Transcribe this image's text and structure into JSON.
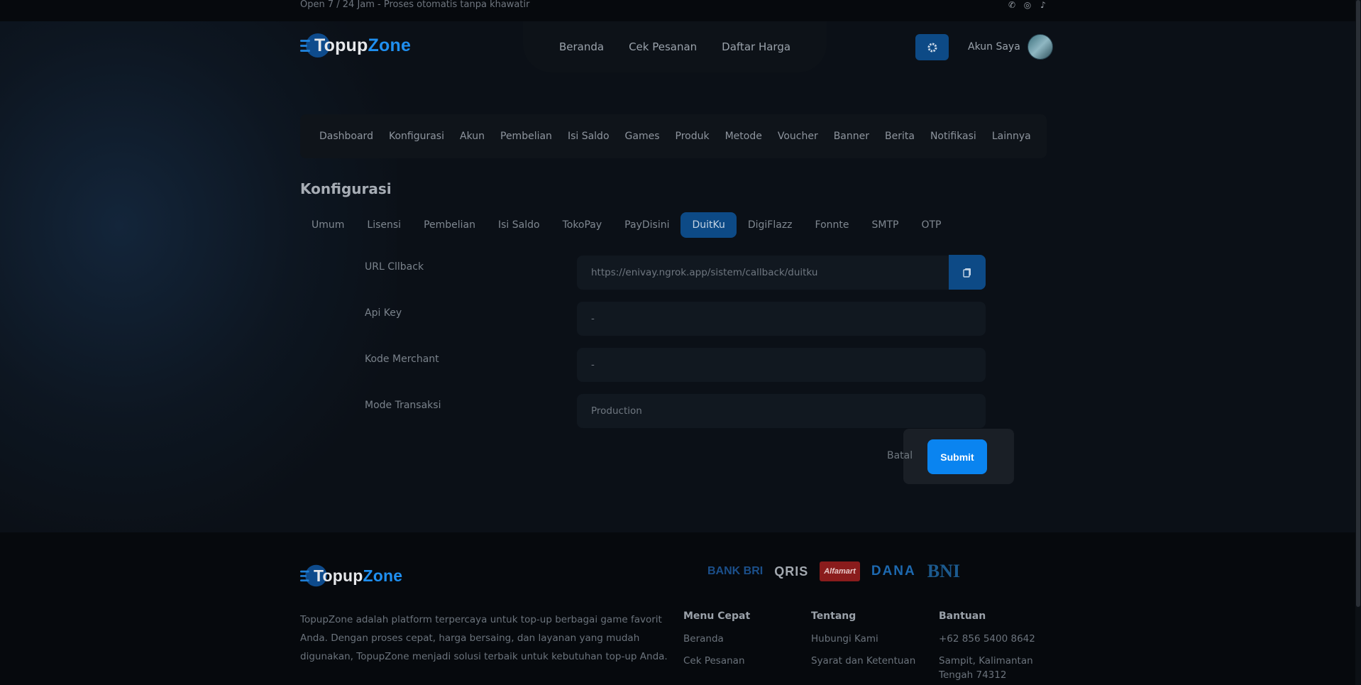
{
  "topbar": {
    "open_text": "Open 7 / 24 Jam - Proses otomatis tanpa khawatir",
    "socials": [
      {
        "icon": "whatsapp-icon"
      },
      {
        "icon": "instagram-icon"
      },
      {
        "icon": "tiktok-icon"
      }
    ]
  },
  "header": {
    "logo": {
      "part1": "Topup",
      "part2": "Z",
      "part3": "o",
      "part4": "ne"
    },
    "nav": [
      "Beranda",
      "Cek Pesanan",
      "Daftar Harga"
    ],
    "account_label": "Akun Saya"
  },
  "admin_nav": [
    "Dashboard",
    "Konfigurasi",
    "Akun",
    "Pembelian",
    "Isi Saldo",
    "Games",
    "Produk",
    "Metode",
    "Voucher",
    "Banner",
    "Berita",
    "Notifikasi",
    "Lainnya"
  ],
  "page_title": "Konfigurasi",
  "tabs": [
    "Umum",
    "Lisensi",
    "Pembelian",
    "Isi Saldo",
    "TokoPay",
    "PayDisini",
    "DuitKu",
    "DigiFlazz",
    "Fonnte",
    "SMTP",
    "OTP"
  ],
  "active_tab": "DuitKu",
  "form": {
    "rows": [
      {
        "label": "URL Cllback",
        "value": "https://enivay.ngrok.app/sistem/callback/duitku"
      },
      {
        "label": "Api Key",
        "value": "-"
      },
      {
        "label": "Kode Merchant",
        "value": "-"
      },
      {
        "label": "Mode Transaksi",
        "value": "Production"
      }
    ],
    "cancel_label": "Batal",
    "submit_label": "Submit"
  },
  "footer": {
    "description": "TopupZone adalah platform terpercaya untuk top-up berbagai game favorit Anda. Dengan proses cepat, harga bersaing, dan layanan yang mudah digunakan, TopupZone menjadi solusi terbaik untuk kebutuhan top-up Anda.",
    "payments": [
      "BANK BRI",
      "QRIS",
      "Alfamart",
      "DANA",
      "BNI"
    ],
    "columns": [
      {
        "title": "Menu Cepat",
        "items": [
          "Beranda",
          "Cek Pesanan"
        ]
      },
      {
        "title": "Tentang",
        "items": [
          "Hubungi Kami",
          "Syarat dan Ketentuan"
        ]
      },
      {
        "title": "Bantuan",
        "items": [
          "+62 856 5400 8642",
          "Sampit, Kalimantan Tengah 74312"
        ]
      }
    ]
  },
  "colors": {
    "accent": "#0a84f0",
    "accent_dark": "#0d4a86",
    "background": "#0b1017"
  }
}
